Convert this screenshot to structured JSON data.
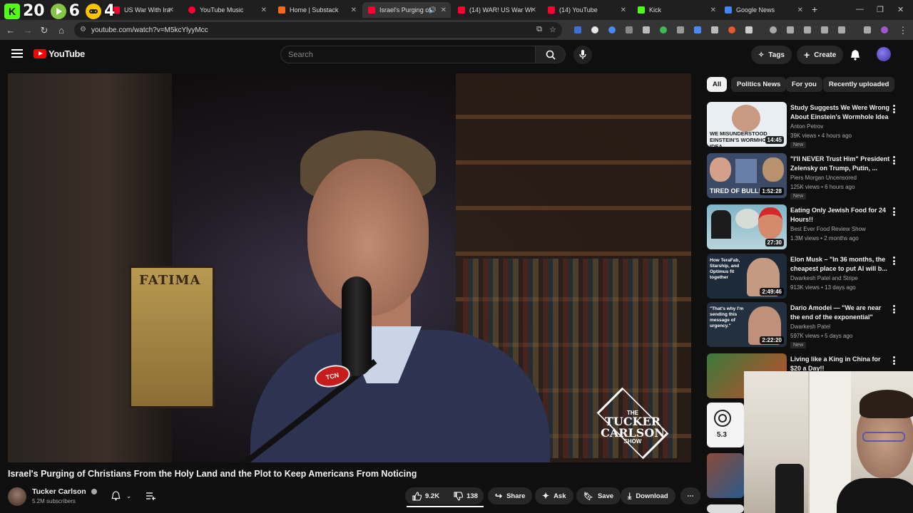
{
  "overlay_counter": [
    {
      "icon": "kick-icon",
      "value": "20",
      "color": "#53fc18"
    },
    {
      "icon": "rumble-icon",
      "value": "6",
      "color": "#85c742"
    },
    {
      "icon": "controller-icon",
      "value": "4",
      "color": "#f7c600"
    }
  ],
  "browser": {
    "tabs": [
      {
        "label": "US War With Ira",
        "color": "#ff0033"
      },
      {
        "label": "YouTube Music",
        "color": "#ff0033"
      },
      {
        "label": "Home | Substack",
        "color": "#ff6719"
      },
      {
        "label": "Israel's Purging of",
        "color": "#ff0033"
      },
      {
        "label": "(14) WAR! US War Wi",
        "color": "#ff0033"
      },
      {
        "label": "(14) YouTube",
        "color": "#ff0033"
      },
      {
        "label": "Kick",
        "color": "#53fc18"
      },
      {
        "label": "Google News",
        "color": "#4285f4"
      }
    ],
    "new_tab": "+",
    "url": "youtube.com/watch?v=M5kcYlyyMcc"
  },
  "header": {
    "logo_text": "YouTube",
    "search_placeholder": "Search",
    "tags_label": "Tags",
    "create_label": "Create"
  },
  "video": {
    "poster_text": "FATIMA",
    "mic_badge": "TCN",
    "show_logo": {
      "line1": "THE",
      "line2": "TUCKER",
      "line3": "CARLSON",
      "line4": "SHOW"
    },
    "title": "Israel's Purging of Christians From the Holy Land and the Plot to Keep Americans From Noticing"
  },
  "channel": {
    "name": "Tucker Carlson",
    "subscribers": "5.2M subscribers"
  },
  "actions": {
    "likes": "9.2K",
    "dislikes": "138",
    "share": "Share",
    "ask": "Ask",
    "save": "Save",
    "download": "Download"
  },
  "chips": [
    "All",
    "Politics News",
    "For you",
    "Recently uploaded"
  ],
  "recommendations": [
    {
      "title": "Study Suggests We Were Wrong About Einstein's Wormhole Idea",
      "channel": "Anton Petrov",
      "meta": "39K views • 4 hours ago",
      "badge": "New",
      "duration": "14:45",
      "thumb_text": "WE MISUNDERSTOOD EINSTEIN'S WORMHOLE IDEA",
      "thumb_bg": "#e9eef3"
    },
    {
      "title": "\"I'll NEVER Trust Him\" President Zelensky on Trump, Putin, ...",
      "channel": "Piers Morgan Uncensored",
      "meta": "125K views • 6 hours ago",
      "badge": "New",
      "duration": "1:52:28",
      "thumb_text": "TIRED OF BULL!",
      "thumb_bg": "#3b4a66"
    },
    {
      "title": "Eating Only Jewish Food for 24 Hours!!",
      "channel": "Best Ever Food Review Show",
      "meta": "1.3M views • 2 months ago",
      "badge": "",
      "duration": "27:30",
      "thumb_text": "",
      "thumb_bg": "#7fb6c8"
    },
    {
      "title": "Elon Musk – \"In 36 months, the cheapest place to put AI will b...",
      "channel": "Dwarkesh Patel and Stripe",
      "meta": "913K views • 13 days ago",
      "badge": "",
      "duration": "2:49:46",
      "thumb_text": "How TeraFab, Starship, and Optimus fit together",
      "thumb_bg": "#1d2a3a"
    },
    {
      "title": "Dario Amodei — \"We are near the end of the exponential\"",
      "channel": "Dwarkesh Patel",
      "meta": "597K views • 5 days ago",
      "badge": "New",
      "duration": "2:22:20",
      "thumb_text": "\"That's why I'm sending this message of urgency.\"",
      "thumb_bg": "#223040"
    },
    {
      "title": "Living like a King in China for $20 a Day!!",
      "channel": "",
      "meta": "",
      "badge": "",
      "duration": "",
      "thumb_text": "",
      "thumb_bg": "#3a7a3a"
    }
  ],
  "partial_thumbs": [
    {
      "label": "5.3",
      "bg": "#f4f4f4"
    }
  ]
}
